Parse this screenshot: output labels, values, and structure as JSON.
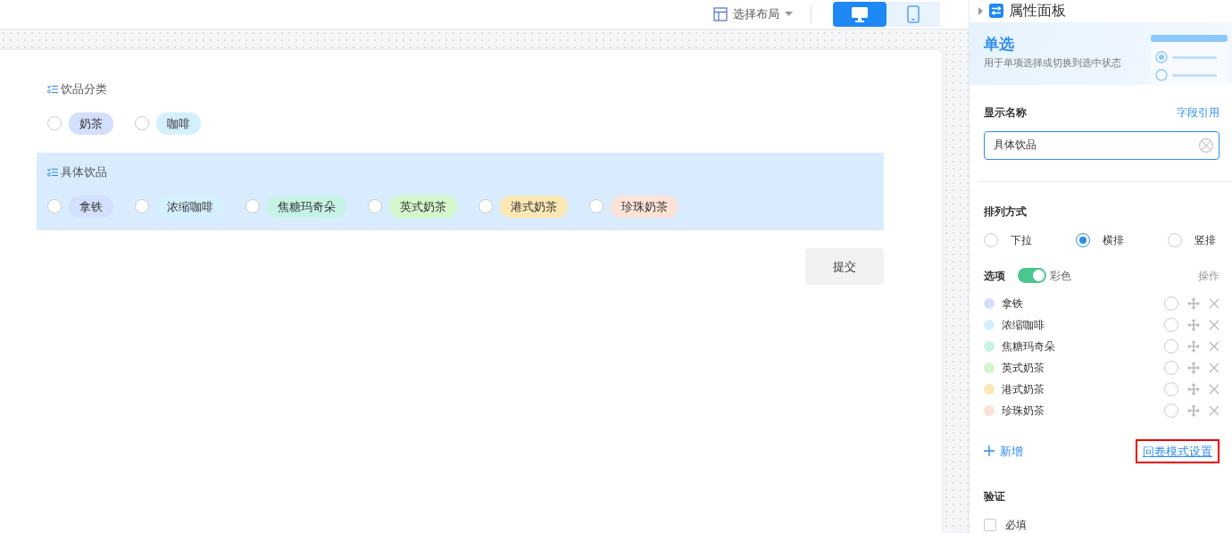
{
  "toolbar": {
    "layout_button": "选择布局",
    "devices": [
      {
        "kind": "desktop",
        "selected": true
      },
      {
        "kind": "mobile",
        "selected": false
      }
    ]
  },
  "form": {
    "fields": [
      {
        "label": "饮品分类",
        "selected": false,
        "options": [
          {
            "label": "奶茶",
            "color": "#d3e0fd",
            "selected": false
          },
          {
            "label": "咖啡",
            "color": "#d5f0fd",
            "selected": false
          }
        ]
      },
      {
        "label": "具体饮品",
        "selected": true,
        "options": [
          {
            "label": "拿铁",
            "color": "#d3e0fd",
            "selected": false
          },
          {
            "label": "浓缩咖啡",
            "color": "#d5f0fd",
            "selected": false
          },
          {
            "label": "焦糖玛奇朵",
            "color": "#c6f3e6",
            "selected": false
          },
          {
            "label": "英式奶茶",
            "color": "#d4f7cc",
            "selected": false
          },
          {
            "label": "港式奶茶",
            "color": "#fde8b5",
            "selected": false
          },
          {
            "label": "珍珠奶茶",
            "color": "#fde2d8",
            "selected": false
          }
        ]
      }
    ],
    "submit": "提交"
  },
  "panel": {
    "title": "属性面板",
    "banner": {
      "title": "单选",
      "description": "用于单项选择或切换到选中状态"
    },
    "display_name": {
      "label": "显示名称",
      "link": "字段引用",
      "value": "具体饮品"
    },
    "arrangement": {
      "label": "排列方式",
      "options": [
        {
          "label": "下拉",
          "selected": false
        },
        {
          "label": "横排",
          "selected": true
        },
        {
          "label": "竖排",
          "selected": false
        }
      ]
    },
    "options_section": {
      "label": "选项",
      "colorful": {
        "on": true,
        "label": "彩色"
      },
      "actions_label": "操作",
      "items": [
        {
          "label": "拿铁",
          "color": "#d3e0fd",
          "default": false
        },
        {
          "label": "浓缩咖啡",
          "color": "#d5f0fd",
          "default": false
        },
        {
          "label": "焦糖玛奇朵",
          "color": "#c6f3e6",
          "default": false
        },
        {
          "label": "英式奶茶",
          "color": "#d4f7cc",
          "default": false
        },
        {
          "label": "港式奶茶",
          "color": "#fde8b5",
          "default": false
        },
        {
          "label": "珍珠奶茶",
          "color": "#fde2d8",
          "default": false
        }
      ]
    },
    "add": "新增",
    "survey_link": {
      "label": "问卷模式设置",
      "highlighted": true
    },
    "validation": {
      "label": "验证",
      "required": {
        "label": "必填",
        "checked": false
      }
    }
  }
}
